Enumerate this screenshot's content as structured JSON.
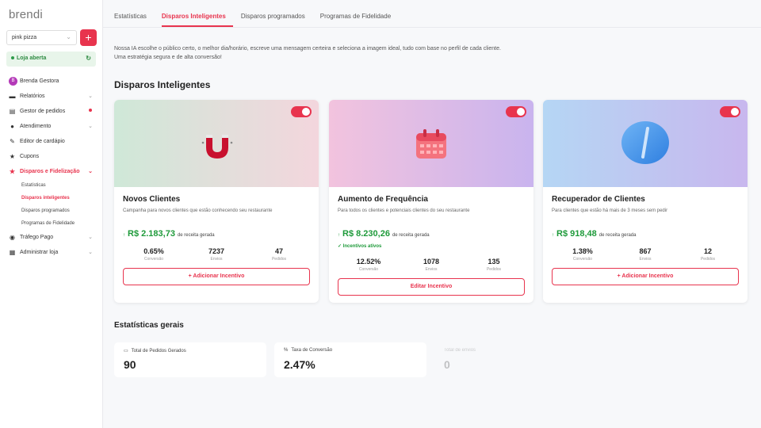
{
  "app": {
    "logo": "brendi"
  },
  "store": {
    "name": "pink pizza",
    "status": "Loja aberta",
    "add_label": "+"
  },
  "user": {
    "initial": "B",
    "name": "Brenda Gestora"
  },
  "menu": [
    {
      "label": "Relatórios",
      "icon": "chart-icon"
    },
    {
      "label": "Gestor de pedidos",
      "icon": "orders-icon"
    },
    {
      "label": "Atendimento",
      "icon": "chat-icon"
    },
    {
      "label": "Editor de cardápio",
      "icon": "pencil-icon"
    },
    {
      "label": "Cupons",
      "icon": "star-icon"
    },
    {
      "label": "Disparos e Fidelização",
      "icon": "star-icon"
    },
    {
      "label": "Tráfego Pago",
      "icon": "globe-icon"
    },
    {
      "label": "Administrar loja",
      "icon": "store-icon"
    }
  ],
  "submenu": [
    "Estatísticas",
    "Disparos inteligentes",
    "Disparos programados",
    "Programas de Fidelidade"
  ],
  "tabs": [
    "Estatísticas",
    "Disparos Inteligentes",
    "Disparos programados",
    "Programas de Fidelidade"
  ],
  "intro": {
    "line1": "Nossa IA escolhe o público certo, o melhor dia/horário, escreve uma mensagem certeira e seleciona a imagem ideal, tudo com base no perfil de cada cliente.",
    "line2": "Uma estratégia segura e de alta conversão!"
  },
  "section_title": "Disparos Inteligentes",
  "cards": [
    {
      "title": "Novos Clientes",
      "desc": "Campanha para novos clientes que estão conhecendo seu restaurante",
      "revenue": "R$ 2.183,73",
      "revenue_suffix": "de receita gerada",
      "incentive": "",
      "stats": [
        {
          "value": "0.65%",
          "label": "Conversão"
        },
        {
          "value": "7237",
          "label": "Envios"
        },
        {
          "value": "47",
          "label": "Pedidos"
        }
      ],
      "button": "+ Adicionar Incentivo",
      "icon": "magnet-icon",
      "toggle_on": true
    },
    {
      "title": "Aumento de Frequência",
      "desc": "Para todos os clientes e potenciais clientes do seu restaurante",
      "revenue": "R$ 8.230,26",
      "revenue_suffix": "de receita gerada",
      "incentive": "Incentivos ativos",
      "stats": [
        {
          "value": "12.52%",
          "label": "Conversão"
        },
        {
          "value": "1078",
          "label": "Envios"
        },
        {
          "value": "135",
          "label": "Pedidos"
        }
      ],
      "button": "Editar Incentivo",
      "icon": "calendar-icon",
      "toggle_on": true
    },
    {
      "title": "Recuperador de Clientes",
      "desc": "Para clientes que estão há mais de 3 meses sem pedir",
      "revenue": "R$ 918,48",
      "revenue_suffix": "de receita gerada",
      "incentive": "",
      "stats": [
        {
          "value": "1.38%",
          "label": "Conversão"
        },
        {
          "value": "867",
          "label": "Envios"
        },
        {
          "value": "12",
          "label": "Pedidos"
        }
      ],
      "button": "+ Adicionar Incentivo",
      "icon": "pill-icon",
      "toggle_on": true
    }
  ],
  "general": {
    "title": "Estatísticas gerais",
    "items": [
      {
        "label": "Total de Pedidos Gerados",
        "value": "90",
        "icon": "receipt-icon"
      },
      {
        "label": "Taxa de Conversão",
        "value": "2.47%",
        "icon": "percent-icon"
      },
      {
        "label": "Total de envios",
        "value": "0",
        "icon": ""
      }
    ]
  },
  "colors": {
    "accent": "#e8344e",
    "positive": "#1e9a3a"
  }
}
